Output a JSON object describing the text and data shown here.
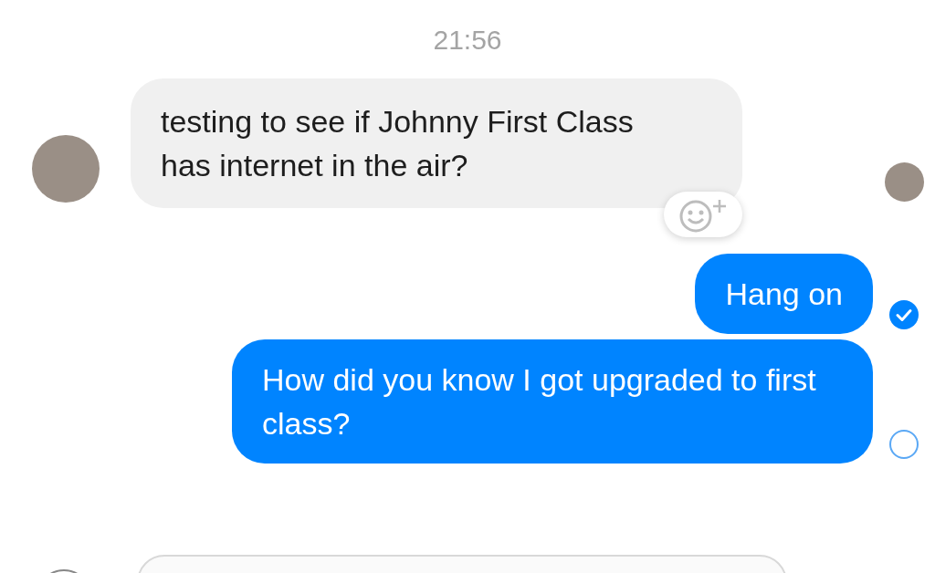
{
  "timestamp": "21:56",
  "messages": [
    {
      "kind": "received",
      "text": "testing to see if Johnny First Class has internet in the air?",
      "reaction_button": true,
      "seen_avatar": true
    },
    {
      "kind": "sent",
      "text": "Hang on",
      "delivered": true
    },
    {
      "kind": "sent",
      "text": "How did you know I got upgraded to first class?",
      "delivered": false
    }
  ]
}
